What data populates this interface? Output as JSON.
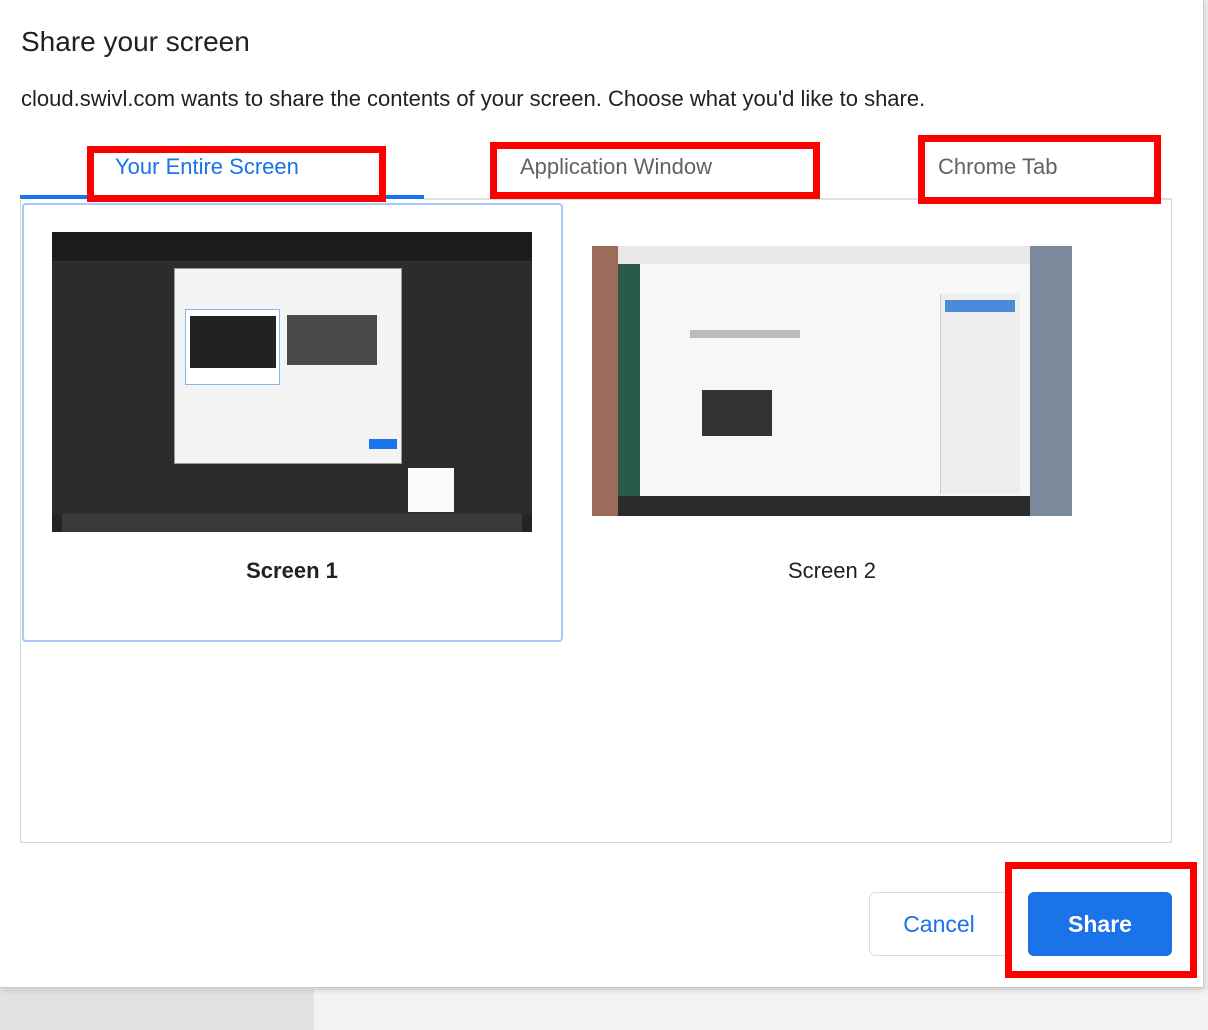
{
  "dialog": {
    "title": "Share your screen",
    "description": "cloud.swivl.com wants to share the contents of your screen. Choose what you'd like to share."
  },
  "tabs": [
    {
      "label": "Your Entire Screen",
      "active": true
    },
    {
      "label": "Application Window",
      "active": false
    },
    {
      "label": "Chrome Tab",
      "active": false
    }
  ],
  "sources": [
    {
      "label": "Screen 1",
      "selected": true
    },
    {
      "label": "Screen 2",
      "selected": false
    }
  ],
  "buttons": {
    "cancel": "Cancel",
    "share": "Share"
  },
  "colors": {
    "accent": "#1a73e8",
    "highlight": "#ff0000",
    "selection_border": "#a8c7fa"
  }
}
